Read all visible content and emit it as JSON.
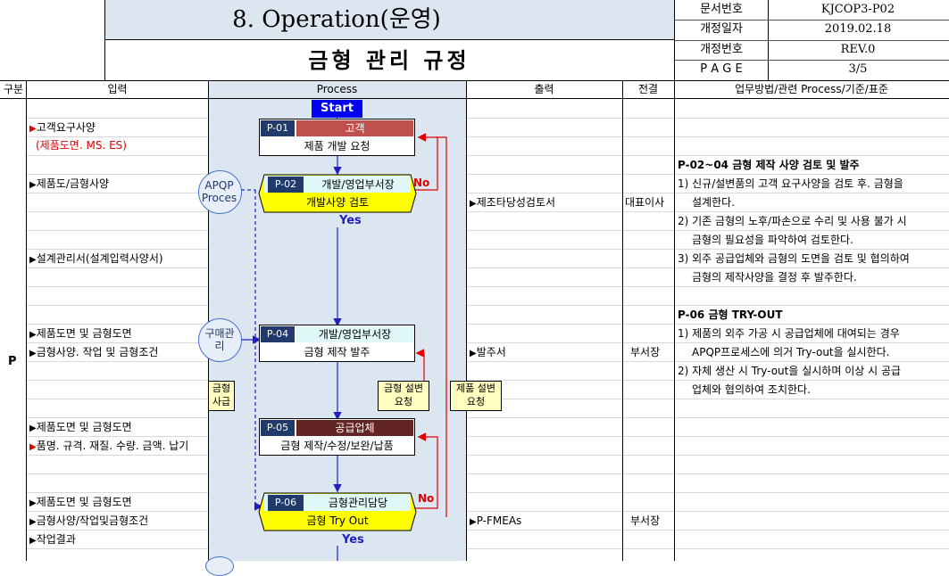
{
  "header": {
    "title": "8. Operation(운영)",
    "subtitle": "금형 관리 규정",
    "meta": [
      {
        "label": "문서번호",
        "value": "KJCOP3-P02"
      },
      {
        "label": "개정일자",
        "value": "2019.02.18"
      },
      {
        "label": "개정번호",
        "value": "REV.0"
      },
      {
        "label": "P A G E",
        "value": "3/5"
      }
    ]
  },
  "columns": {
    "gubun": "구분",
    "input": "입력",
    "process": "Process",
    "output": "출력",
    "approval": "전결",
    "method": "업무방법/관련 Process/기준/표준"
  },
  "phase": "P",
  "inputs": [
    {
      "text": "고객요구사양",
      "marker": "▶",
      "red_marker": true
    },
    {
      "text": "(제품도면. MS. ES)",
      "red": true
    },
    {
      "text": "제품도/금형사양",
      "marker": "▶"
    },
    {
      "text": "설계관리서(설계입력사양서)",
      "marker": "▶"
    },
    {
      "text": "제품도면 및 금형도면",
      "marker": "▶"
    },
    {
      "text": "금형사양. 작업 및 금형조건",
      "marker": "▶"
    },
    {
      "text": "제품도면 및 금형도면",
      "marker": "▶"
    },
    {
      "text": "품명. 규격. 재질. 수량. 금액. 납기",
      "marker": "▶",
      "red_marker": true
    },
    {
      "text": "제품도면 및 금형도면",
      "marker": "▶"
    },
    {
      "text": "금형사양/작업및금형조건",
      "marker": "▶"
    },
    {
      "text": "작업결과",
      "marker": "▶"
    }
  ],
  "process": {
    "start": "Start",
    "steps": [
      {
        "id": "P-01",
        "owner": "고객",
        "task": "제품 개발 요청"
      },
      {
        "id": "P-02",
        "owner": "개발/영업부서장",
        "task": "개발사양 검토"
      },
      {
        "id": "P-04",
        "owner": "개발/영업부서장",
        "task": "금형 제작 발주"
      },
      {
        "id": "P-05",
        "owner": "공급업체",
        "task": "금형 제작/수정/보완/납품"
      },
      {
        "id": "P-06",
        "owner": "금형관리담당",
        "task": "금형 Try Out"
      }
    ],
    "yes": "Yes",
    "no": "No",
    "side_circles": [
      "APQP Proces",
      "구매관리"
    ],
    "callouts": [
      "금형 사급",
      "금형 설변 요청",
      "제품 설변 요청"
    ]
  },
  "outputs": [
    {
      "text": "제조타당성검토서",
      "marker": "▶",
      "approval": "대표이사"
    },
    {
      "text": "발주서",
      "marker": "▶",
      "approval": "부서장"
    },
    {
      "text": "P-FMEAs",
      "marker": "▶",
      "approval": "부서장"
    }
  ],
  "method": {
    "sections": [
      {
        "heading": "P-02~04 금형 제작 사양 검토 및 발주",
        "lines": [
          "1) 신규/설변품의 고객 요구사양을 검토 후. 금형을",
          "설계한다.",
          "2) 기존 금형의 노후/파손으로 수리 및 사용 불가 시",
          "금형의 필요성을 파악하여 검토한다.",
          "3) 외주 공급업체와 금형의 도면을 검토 및 협의하여",
          "금형의 제작사양을 결정 후 발주한다."
        ]
      },
      {
        "heading": "P-06 금형 TRY-OUT",
        "lines": [
          "1) 제품의 외주 가공 시 공급업체에 대여되는 경우",
          "APQP프로세스에 의거 Try-out을 실시한다.",
          "2) 자체 생산 시 Try-out을 실시하며 이상 시 공급",
          "업체와 협의하여 조치한다."
        ]
      }
    ]
  }
}
